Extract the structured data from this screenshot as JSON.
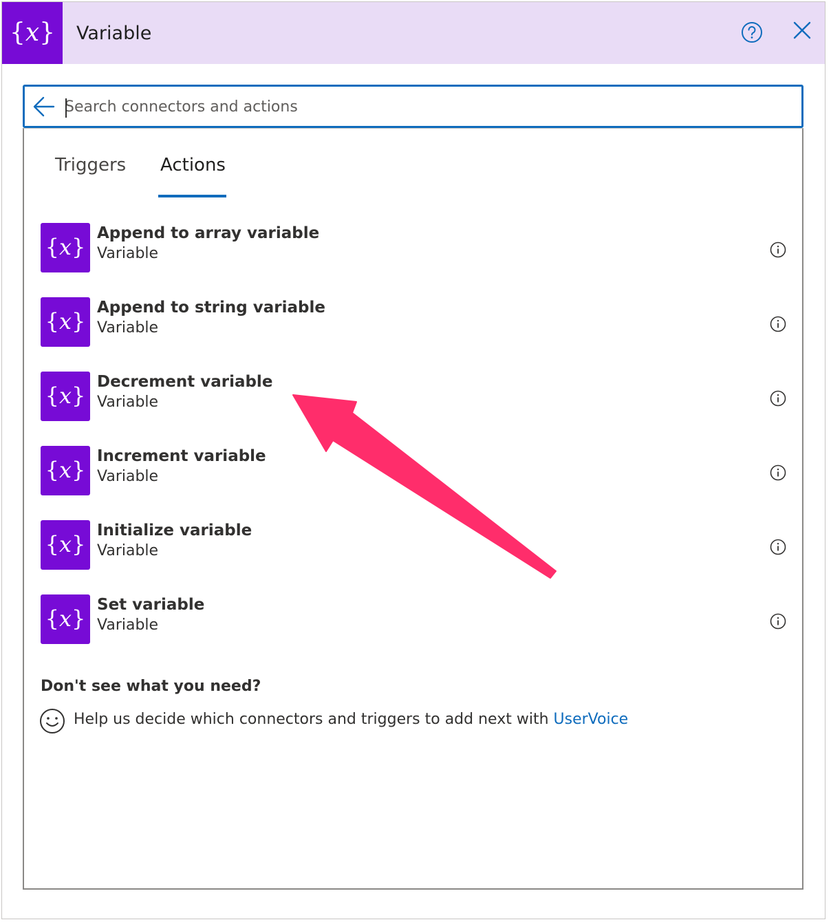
{
  "header": {
    "title": "Variable",
    "icon": "variable-curly-x-icon",
    "accent": "#770bd6",
    "background": "#e9dcf6"
  },
  "search": {
    "placeholder": "Search connectors and actions",
    "value": ""
  },
  "tabs": [
    {
      "label": "Triggers",
      "selected": false
    },
    {
      "label": "Actions",
      "selected": true
    }
  ],
  "actions": [
    {
      "title": "Append to array variable",
      "subtitle": "Variable"
    },
    {
      "title": "Append to string variable",
      "subtitle": "Variable"
    },
    {
      "title": "Decrement variable",
      "subtitle": "Variable"
    },
    {
      "title": "Increment variable",
      "subtitle": "Variable"
    },
    {
      "title": "Initialize variable",
      "subtitle": "Variable"
    },
    {
      "title": "Set variable",
      "subtitle": "Variable"
    }
  ],
  "footer": {
    "heading": "Don't see what you need?",
    "help_text": "Help us decide which connectors and triggers to add next with ",
    "link_text": "UserVoice"
  },
  "colors": {
    "link": "#0f6cbd",
    "annotation_arrow": "#ff2d6b"
  }
}
